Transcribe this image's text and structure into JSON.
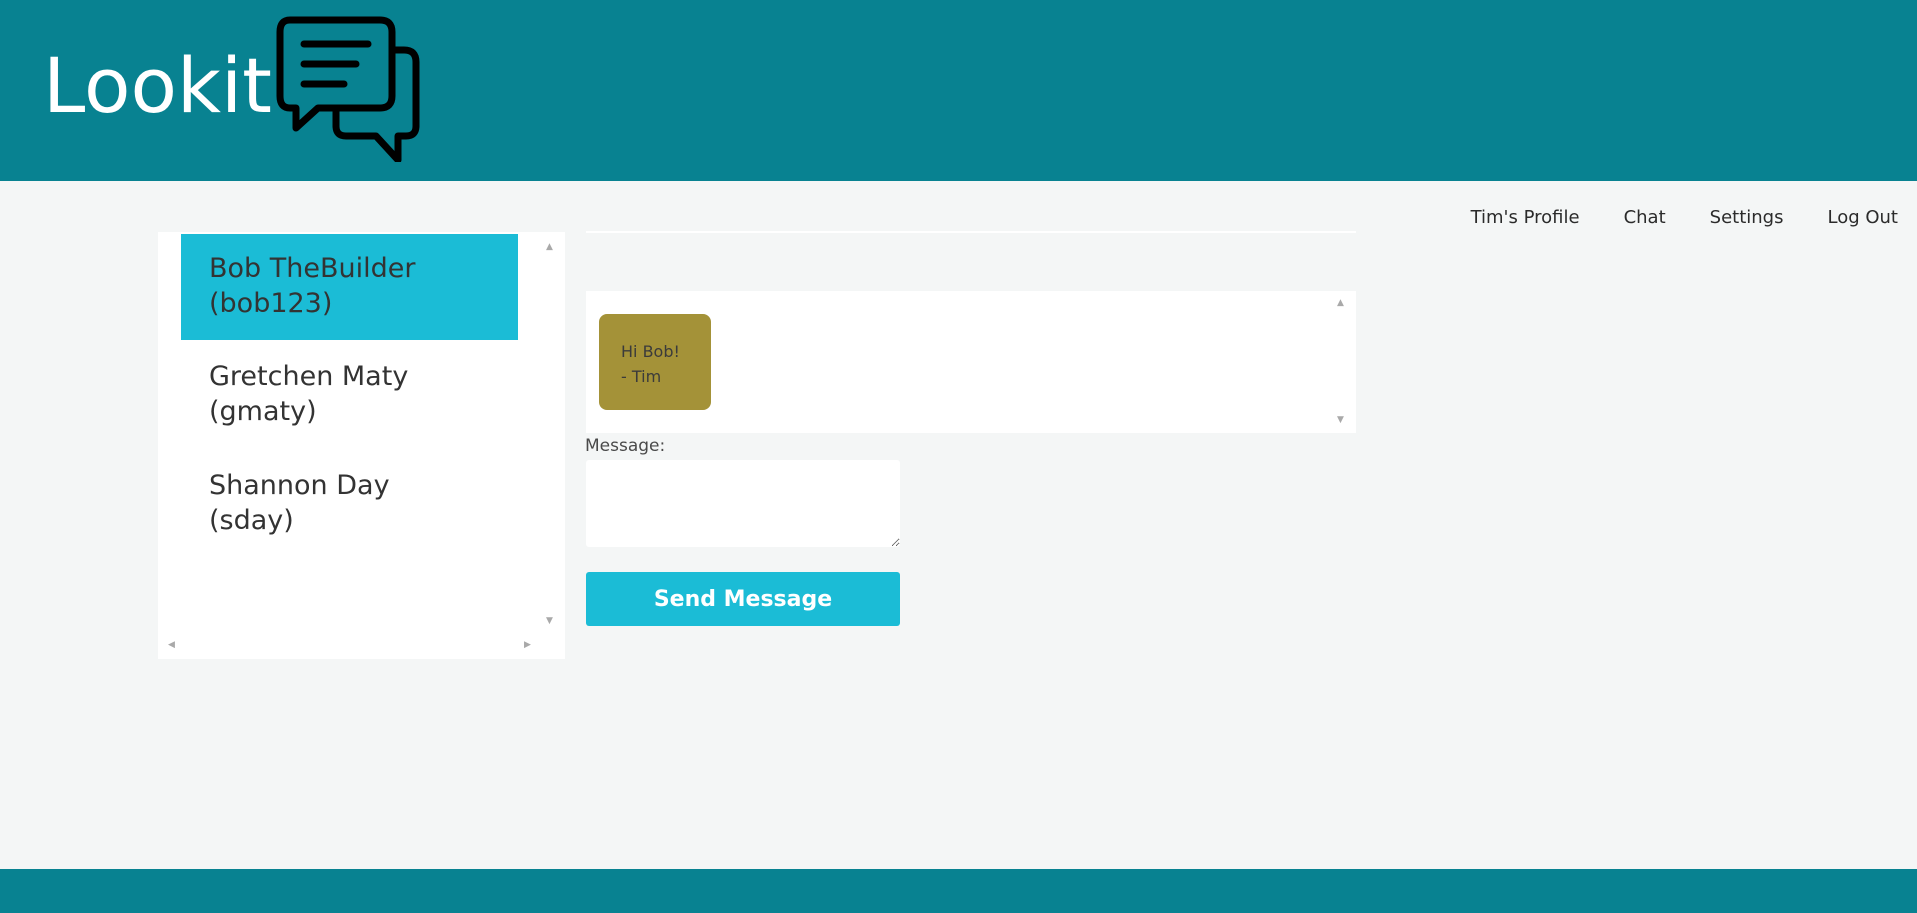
{
  "header": {
    "app_name": "Lookit",
    "logo_icon": "chat-bubbles-icon",
    "background_color": "#088291"
  },
  "nav": {
    "items": [
      {
        "label": "Tim's Profile"
      },
      {
        "label": "Chat"
      },
      {
        "label": "Settings"
      },
      {
        "label": "Log Out"
      }
    ]
  },
  "contacts": {
    "selected_color": "#1bbcd6",
    "items": [
      {
        "name": "Bob TheBuilder",
        "username": "(bob123)",
        "selected": true
      },
      {
        "name": "Gretchen Maty",
        "username": "(gmaty)",
        "selected": false
      },
      {
        "name": "Shannon Day",
        "username": "(sday)",
        "selected": false
      }
    ]
  },
  "messages": {
    "items": [
      {
        "line1": "Hi Bob!",
        "line2": "- Tim",
        "color": "#a49238"
      }
    ]
  },
  "composer": {
    "label": "Message:",
    "value": "",
    "send_label": "Send Message",
    "button_color": "#1bbcd6"
  }
}
